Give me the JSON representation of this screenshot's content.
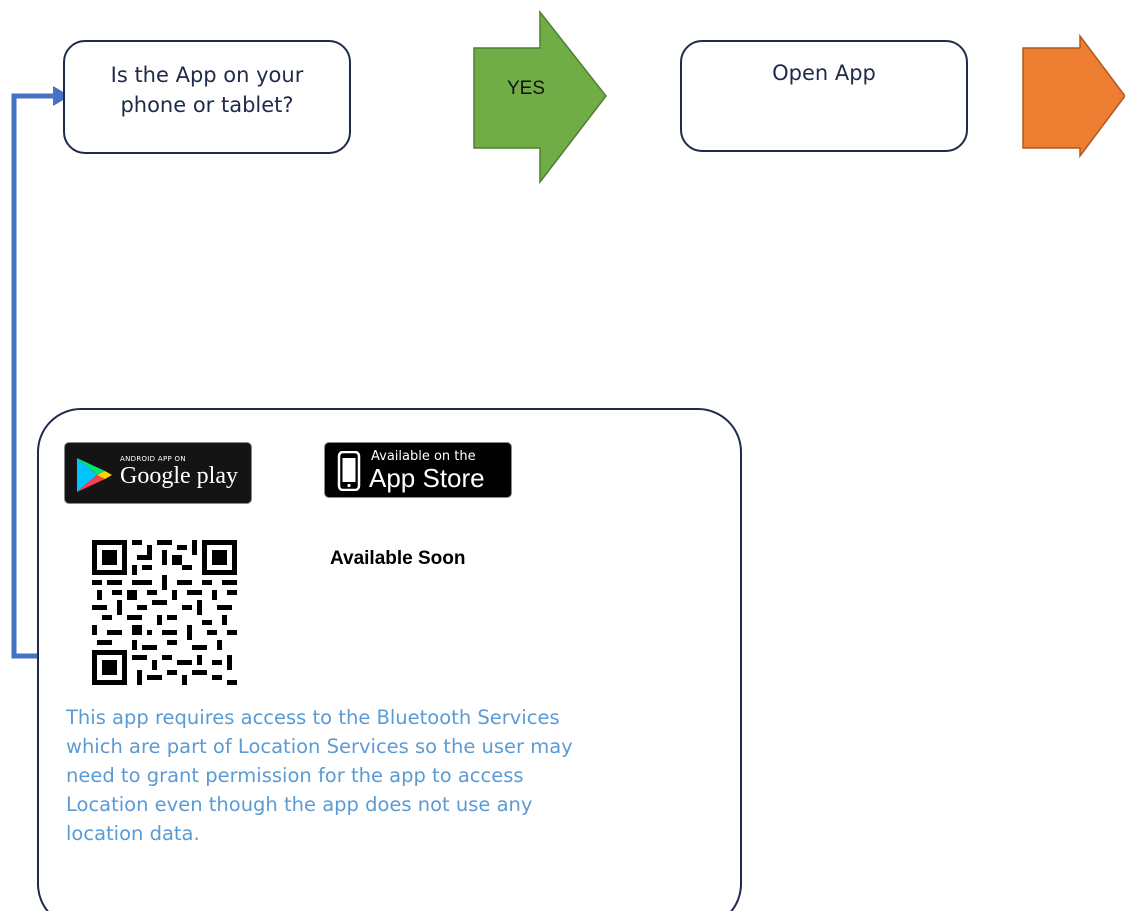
{
  "question_box": {
    "text_line1": "Is the App on your",
    "text_line2": "phone or tablet?"
  },
  "yes_arrow": {
    "label": "YES",
    "color": "#70ad47",
    "border": "#507e32"
  },
  "open_app_box": {
    "text": "Open App"
  },
  "next_arrow": {
    "color": "#ed7d31",
    "border": "#ae5a21"
  },
  "loop_connector": {
    "color": "#4472c4"
  },
  "panel": {
    "google_badge": {
      "small_text": "ANDROID APP ON",
      "big_text": "Google play"
    },
    "apple_badge": {
      "small_text": "Available on the",
      "big_text": "App Store"
    },
    "available_soon": "Available Soon",
    "note_lines": [
      "This app requires access to the Bluetooth Services",
      "which are part of Location Services so the user may",
      "need to grant permission for the app to access",
      "Location even though the app does not use any",
      "location data."
    ],
    "note_color": "#5b9bd5"
  }
}
